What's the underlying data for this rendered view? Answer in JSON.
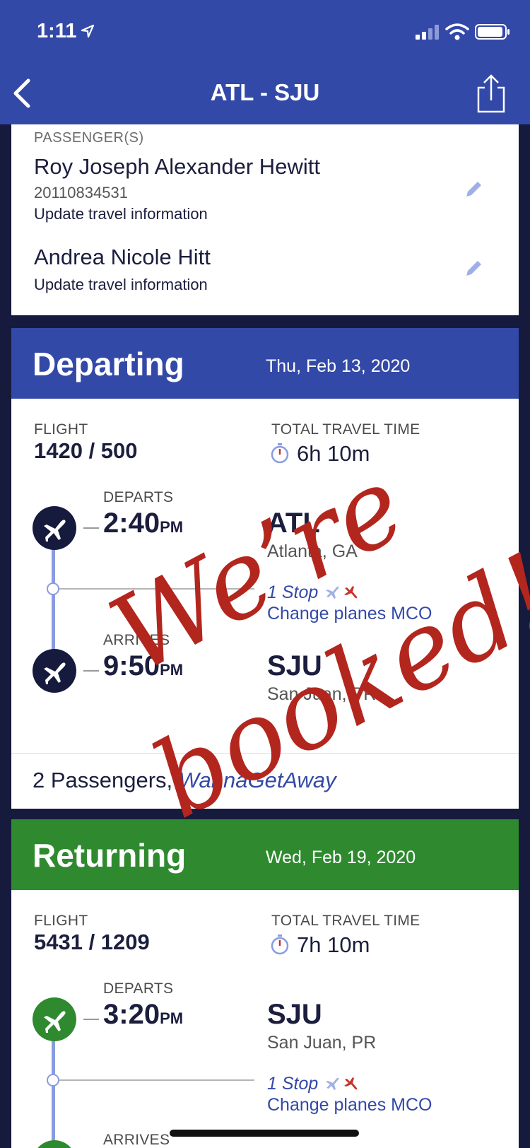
{
  "status_bar": {
    "time": "1:11"
  },
  "nav": {
    "title": "ATL - SJU"
  },
  "passengers": {
    "label": "PASSENGER(S)",
    "list": [
      {
        "name": "Roy Joseph Alexander Hewitt",
        "number": "20110834531",
        "link": "Update travel information"
      },
      {
        "name": "Andrea Nicole Hitt",
        "link": "Update travel information"
      }
    ]
  },
  "departing": {
    "title": "Departing",
    "date": "Thu, Feb 13, 2020",
    "flight_label": "FLIGHT",
    "flight": "1420 / 500",
    "travel_time_label": "TOTAL TRAVEL TIME",
    "travel_time": "6h 10m",
    "departs_label": "DEPARTS",
    "departs_time": "2:40",
    "departs_ampm": "PM",
    "origin_code": "ATL",
    "origin_city": "Atlanta, GA",
    "stops": "1 Stop",
    "change": "Change planes MCO",
    "arrives_label": "ARRIVES",
    "arrives_time": "9:50",
    "arrives_ampm": "PM",
    "dest_code": "SJU",
    "dest_city": "San Juan, PR",
    "pax_count": "2 Passengers,",
    "fare": "WannaGetAway",
    "header_color": "#3349a8",
    "icon_color": "#161a3d"
  },
  "returning": {
    "title": "Returning",
    "date": "Wed, Feb 19, 2020",
    "flight_label": "FLIGHT",
    "flight": "5431 / 1209",
    "travel_time_label": "TOTAL TRAVEL TIME",
    "travel_time": "7h 10m",
    "departs_label": "DEPARTS",
    "departs_time": "3:20",
    "departs_ampm": "PM",
    "origin_code": "SJU",
    "origin_city": "San Juan, PR",
    "stops": "1 Stop",
    "change": "Change planes MCO",
    "arrives_label": "ARRIVES",
    "header_color": "#2f8a2f",
    "icon_color": "#2f8a2f"
  },
  "overlay": {
    "line1": "We’re",
    "line2": "booked!",
    "color": "#b3261e"
  }
}
